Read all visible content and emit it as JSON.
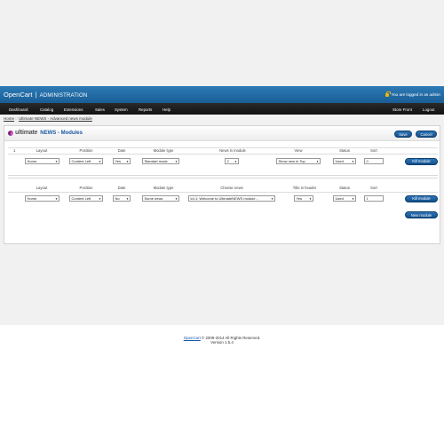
{
  "header": {
    "brand": "OpenCart",
    "separator": "|",
    "section": "ADMINISTRATION",
    "logged_in": "You are logged in as admin"
  },
  "menu": {
    "items": [
      "Dashboard",
      "Catalog",
      "Extensions",
      "Sales",
      "System",
      "Reports",
      "Help"
    ],
    "right_items": [
      "Store Front",
      "Logout"
    ]
  },
  "breadcrumb": {
    "home": "Home",
    "separator": "::",
    "current": "Ultimate NEWS - Advanced news module"
  },
  "module": {
    "logo_word": "ultimate",
    "title": "NEWS - Modules",
    "save_label": "Save",
    "cancel_label": "Cancel",
    "kill_label": "Kill module",
    "new_label": "New module"
  },
  "table1": {
    "headers": [
      "Layout",
      "Position",
      "Date",
      "Module type",
      "News in module",
      "View",
      "Status",
      "Sort"
    ],
    "row_number": "1",
    "values": {
      "layout": "Home",
      "position": "Content Left",
      "date": "Yes",
      "module_type": "Standart mode",
      "news_in_module": "2",
      "view": "Show new in Top",
      "status": "Used",
      "sort": "0"
    }
  },
  "table2": {
    "headers": [
      "Layout",
      "Position",
      "Date",
      "Module type",
      "Choose news",
      "Title in header",
      "Status",
      "Sort"
    ],
    "values": {
      "layout": "Home",
      "position": "Content Left",
      "date": "No",
      "module_type": "Some news",
      "choose_news": "id=1: Welcome to UltimateNEWS module...",
      "title_in_header": "Yes",
      "status": "Used",
      "sort": "1"
    }
  },
  "footer": {
    "link": "OpenCart",
    "copyright": "© 2009-2014 All Rights Reserved.",
    "version": "Version 1.5.4"
  }
}
